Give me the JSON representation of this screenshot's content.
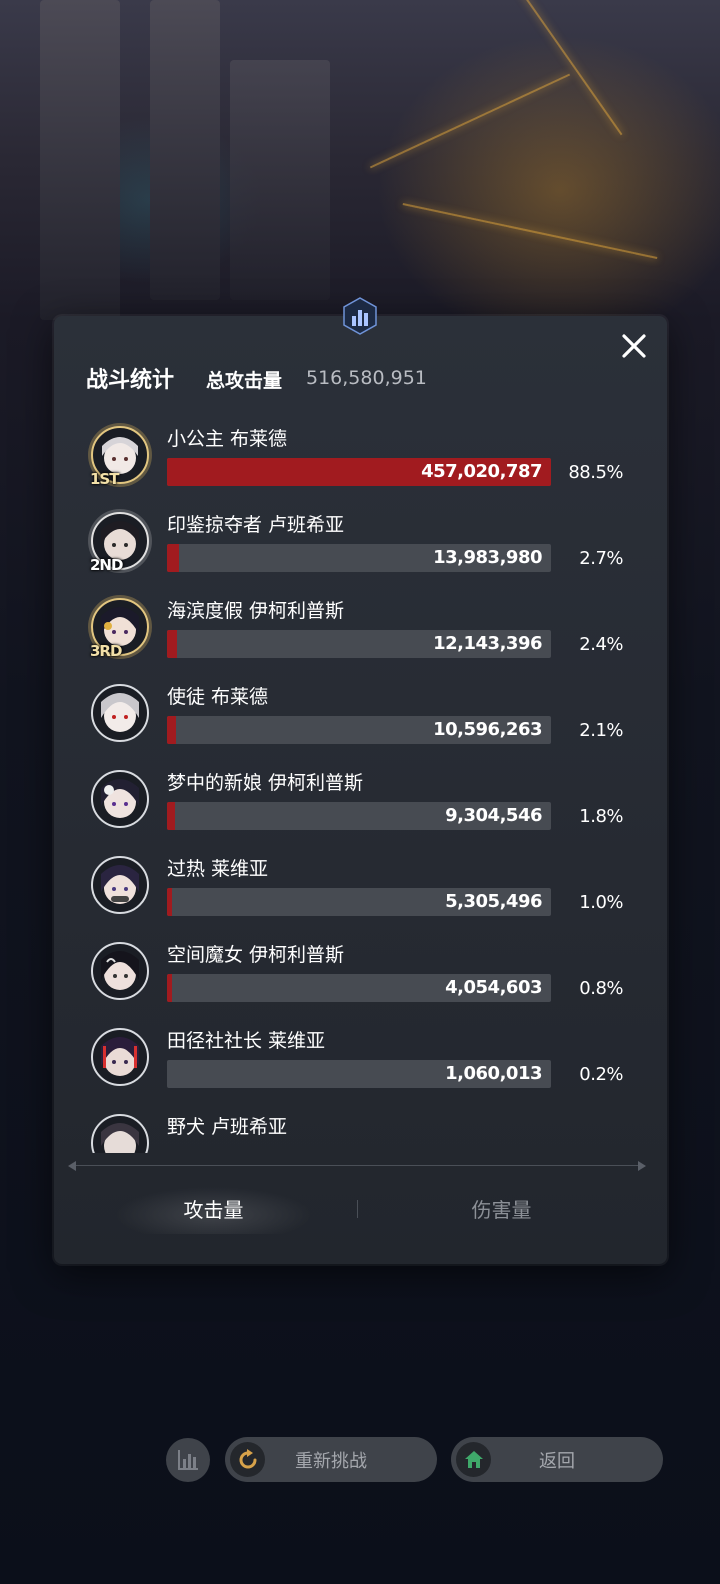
{
  "panel": {
    "title": "战斗统计",
    "total_label": "总攻击量",
    "total_value": "516,580,951"
  },
  "rows": [
    {
      "name": "小公主 布莱德",
      "value": "457,020,787",
      "percent": "88.5%",
      "fill": 1.0,
      "rank": "1ST",
      "rank_style": "gold"
    },
    {
      "name": "印鉴掠夺者 卢班希亚",
      "value": "13,983,980",
      "percent": "2.7%",
      "fill": 0.031,
      "rank": "2ND",
      "rank_style": "silver"
    },
    {
      "name": "海滨度假 伊柯利普斯",
      "value": "12,143,396",
      "percent": "2.4%",
      "fill": 0.027,
      "rank": "3RD",
      "rank_style": "gold"
    },
    {
      "name": "使徒 布莱德",
      "value": "10,596,263",
      "percent": "2.1%",
      "fill": 0.024,
      "rank": "",
      "rank_style": "none"
    },
    {
      "name": "梦中的新娘 伊柯利普斯",
      "value": "9,304,546",
      "percent": "1.8%",
      "fill": 0.021,
      "rank": "",
      "rank_style": "none"
    },
    {
      "name": "过热 莱维亚",
      "value": "5,305,496",
      "percent": "1.0%",
      "fill": 0.012,
      "rank": "",
      "rank_style": "none"
    },
    {
      "name": "空间魔女 伊柯利普斯",
      "value": "4,054,603",
      "percent": "0.8%",
      "fill": 0.009,
      "rank": "",
      "rank_style": "none"
    },
    {
      "name": "田径社社长 莱维亚",
      "value": "1,060,013",
      "percent": "0.2%",
      "fill": 0.0,
      "rank": "",
      "rank_style": "none"
    },
    {
      "name": "野犬 卢班希亚",
      "value": "",
      "percent": "",
      "fill": 0.0,
      "rank": "",
      "rank_style": "none"
    }
  ],
  "tabs": {
    "attack": "攻击量",
    "damage": "伤害量"
  },
  "bottom": {
    "retry": "重新挑战",
    "back": "返回"
  },
  "colors": {
    "bar_fill": "#a11b1f",
    "bar_track": "#474b52",
    "panel_bg": "#2b3039"
  }
}
